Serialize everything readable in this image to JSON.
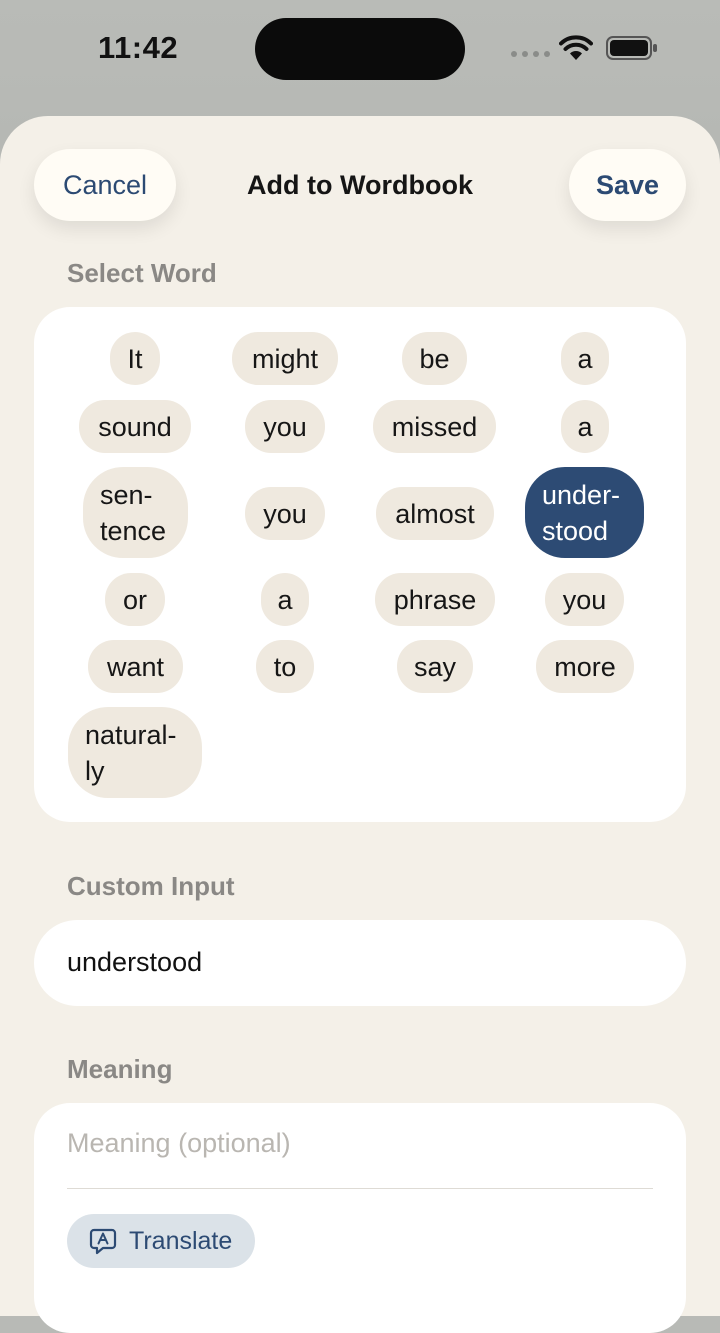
{
  "status_bar": {
    "time": "11:42"
  },
  "header": {
    "cancel_label": "Cancel",
    "title": "Add to Wordbook",
    "save_label": "Save"
  },
  "select_word": {
    "label": "Select Word",
    "words": [
      "It",
      "might",
      "be",
      "a",
      "sound",
      "you",
      "missed",
      "a",
      "sen-\ntence",
      "you",
      "almost",
      "under-\nstood",
      "or",
      "a",
      "phrase",
      "you",
      "want",
      "to",
      "say",
      "more",
      "natural-\nly"
    ],
    "selected_word": "under-\nstood"
  },
  "custom_input": {
    "label": "Custom Input",
    "value": "understood"
  },
  "meaning": {
    "label": "Meaning",
    "placeholder": "Meaning (optional)",
    "translate_label": "Translate"
  },
  "colors": {
    "accent": "#2d4b74",
    "sheet_bg": "#f4f0e8",
    "chip_bg": "#efe9df"
  },
  "icons": {
    "translate": "translate-bubble-icon",
    "wifi": "wifi-icon",
    "battery": "battery-icon"
  }
}
